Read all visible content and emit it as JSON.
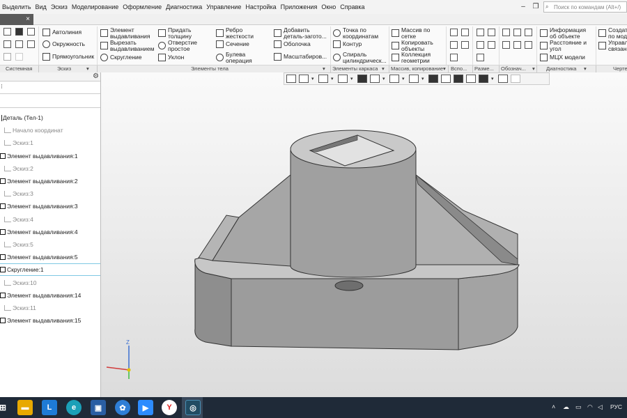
{
  "menu": {
    "items": [
      "Выделить",
      "Вид",
      "Эскиз",
      "Моделирование",
      "Оформление",
      "Диагностика",
      "Управление",
      "Настройка",
      "Приложения",
      "Окно",
      "Справка"
    ],
    "search_placeholder": "Поиск по командам (Alt+/)"
  },
  "tab": {
    "close": "×"
  },
  "ribbon": {
    "sketch_tools": {
      "autoline": "Автолиния",
      "circle": "Окружность",
      "rectangle": "Прямоугольник"
    },
    "body_tools": {
      "extrude": "Элемент выдавливания",
      "cut_extrude": "Вырезать выдавливанием",
      "fillet": "Скругление",
      "add_thickness": "Придать толщину",
      "hole": "Отверстие простое",
      "draft": "Уклон",
      "rib": "Ребро жесткости",
      "section": "Сечение",
      "boolean": "Булева операция",
      "add_part": "Добавить деталь-загото...",
      "shell": "Оболочка",
      "scale": "Масштабиров..."
    },
    "frame_tools": {
      "point": "Точка по координатам",
      "contour": "Контур",
      "spiral": "Спираль цилиндрическ..."
    },
    "array_tools": {
      "grid_array": "Массив по сетке",
      "copy": "Копировать объекты",
      "geometry": "Коллекция геометрии"
    },
    "diag_tools": {
      "info": "Информация об объекте",
      "distance": "Расстояние и угол",
      "mass": "МЦХ модели"
    },
    "manage_tools": {
      "create": "Создат по мод",
      "control": "Управл связан"
    },
    "groups": [
      "Системная",
      "Эскиз",
      "Элементы тела",
      "Элементы каркаса",
      "Массив, копирование",
      "Вспо...",
      "Разме...",
      "Обознач...",
      "Диагностика",
      "Черте"
    ]
  },
  "tree": {
    "root": "Деталь (Тел-1)",
    "items": [
      {
        "label": "Начало координат",
        "type": "origin"
      },
      {
        "label": "Эскиз:1",
        "type": "sketch"
      },
      {
        "label": "Элемент выдавливания:1",
        "type": "feature"
      },
      {
        "label": "Эскиз:2",
        "type": "sketch"
      },
      {
        "label": "Элемент выдавливания:2",
        "type": "feature"
      },
      {
        "label": "Эскиз:3",
        "type": "sketch"
      },
      {
        "label": "Элемент выдавливания:3",
        "type": "feature"
      },
      {
        "label": "Эскиз:4",
        "type": "sketch"
      },
      {
        "label": "Элемент выдавливания:4",
        "type": "feature"
      },
      {
        "label": "Эскиз:5",
        "type": "sketch"
      },
      {
        "label": "Элемент выдавливания:5",
        "type": "feature"
      },
      {
        "label": "Скругление:1",
        "type": "feature"
      },
      {
        "label": "Эскиз:10",
        "type": "sketch"
      },
      {
        "label": "Элемент выдавливания:14",
        "type": "feature"
      },
      {
        "label": "Эскиз:11",
        "type": "sketch"
      },
      {
        "label": "Элемент выдавливания:15",
        "type": "feature"
      }
    ]
  },
  "axis": {
    "z": "Z"
  },
  "taskbar": {
    "lang": "РУС"
  },
  "colors": {
    "accent": "#2f6fb3",
    "part_fill": "#a8a8a8",
    "taskbar": "#1f2a38"
  }
}
